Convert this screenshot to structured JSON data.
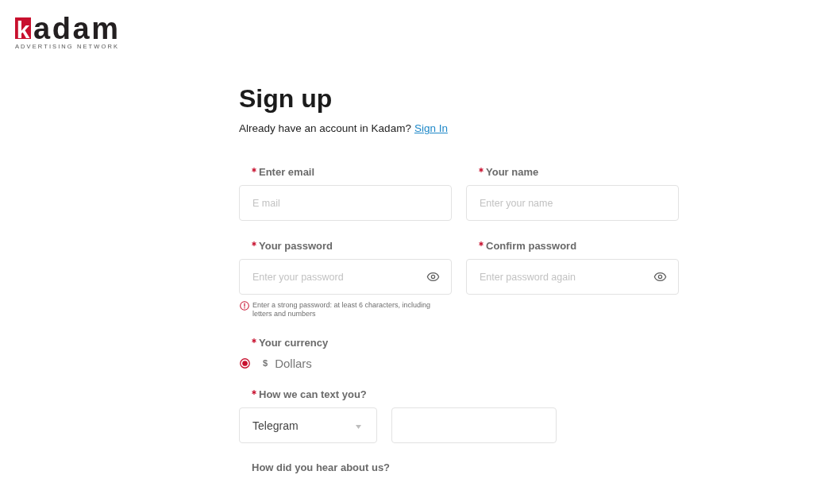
{
  "logo": {
    "mark": "k",
    "wordmark": "adam",
    "tagline": "ADVERTISING NETWORK"
  },
  "heading": "Sign up",
  "signin_prompt": {
    "text": "Already have an account in Kadam?",
    "link": "Sign In"
  },
  "fields": [
    {
      "label": "Enter email",
      "required": true,
      "kind": "text",
      "placeholder": "E mail"
    },
    {
      "label": "Your name",
      "required": true,
      "kind": "text",
      "placeholder": "Enter your name"
    },
    {
      "label": "Your password",
      "required": true,
      "kind": "password",
      "placeholder": "Enter your password",
      "hint": "Enter a strong password: at least 6 characters, including letters and numbers"
    },
    {
      "label": "Confirm password",
      "required": true,
      "kind": "password",
      "placeholder": "Enter password again"
    }
  ],
  "currency": {
    "label": "Your currency",
    "required": true,
    "options": [
      {
        "symbol": "$",
        "label": "Dollars",
        "selected": true
      }
    ]
  },
  "contact": {
    "label": "How we can text you?",
    "required": true,
    "method": "Telegram"
  },
  "referral": {
    "label": "How did you hear about us?",
    "required": false
  }
}
